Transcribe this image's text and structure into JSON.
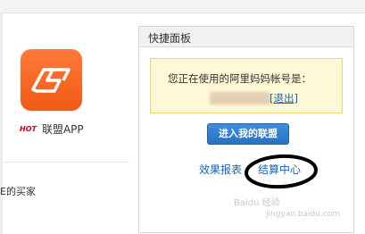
{
  "app": {
    "hot_badge": "HOT",
    "name": "联盟APP"
  },
  "left_text": "E的买家",
  "panel": {
    "title": "快捷面板",
    "notice_text": "您正在使用的阿里妈妈帐号是：",
    "logout_open": "[",
    "logout_label": "退出",
    "logout_close": "]",
    "enter_button": "进入我的联盟",
    "link_report": "效果报表",
    "link_settlement": "结算中心"
  },
  "watermark": {
    "text": "Baidu 经验",
    "url": "jingyan.baidu.com"
  },
  "colors": {
    "accent_blue": "#2770c6",
    "link_blue": "#1a62b3",
    "hot_red": "#d6000f",
    "logo_orange": "#f05a14",
    "notice_bg": "#fff8d6"
  }
}
